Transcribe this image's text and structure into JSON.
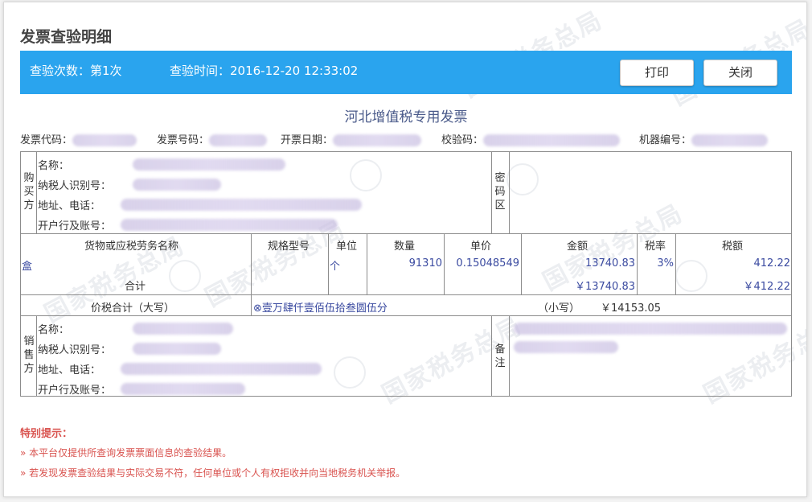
{
  "header": {
    "title": "发票查验明细"
  },
  "bar": {
    "count_text": "查验次数：第1次",
    "time_text": "查验时间：2016-12-20 12:33:02",
    "print_label": "打印",
    "close_label": "关闭"
  },
  "invoice": {
    "title": "河北增值税专用发票",
    "meta": {
      "code_label": "发票代码：",
      "number_label": "发票号码：",
      "date_label": "开票日期：",
      "check_label": "校验码：",
      "machine_label": "机器编号："
    },
    "buyer": {
      "side_label": "购买方",
      "name": "名称：",
      "tax_id": "纳税人识别号：",
      "address": "地址、电话：",
      "bank": "开户行及账号："
    },
    "code_area_label": "密码区",
    "items": {
      "headers": [
        "货物或应税劳务名称",
        "规格型号",
        "单位",
        "数量",
        "单价",
        "金额",
        "税率",
        "税额"
      ],
      "row": {
        "name": "盒",
        "unit": "个",
        "quantity": "91310",
        "price": "0.15048549",
        "amount": "13740.83",
        "rate": "3%",
        "tax": "412.22"
      },
      "total": {
        "label": "合计",
        "amount": "￥13740.83",
        "tax": "￥412.22"
      }
    },
    "sum": {
      "label": "价税合计（大写）",
      "upper": "⊗壹万肆仟壹佰伍拾叁圆伍分",
      "lower_label": "（小写）",
      "lower_value": "￥14153.05"
    },
    "seller": {
      "side_label": "销售方",
      "name": "名称：",
      "tax_id": "纳税人识别号：",
      "address": "地址、电话：",
      "bank": "开户行及账号："
    },
    "remark_label": "备注"
  },
  "tips": {
    "title": "特别提示：",
    "items": [
      "» 本平台仅提供所查询发票票面信息的查验结果。",
      "» 若发现发票查验结果与实际交易不符，任何单位或个人有权拒收并向当地税务机关举报。"
    ]
  },
  "watermark": "国家税务总局"
}
